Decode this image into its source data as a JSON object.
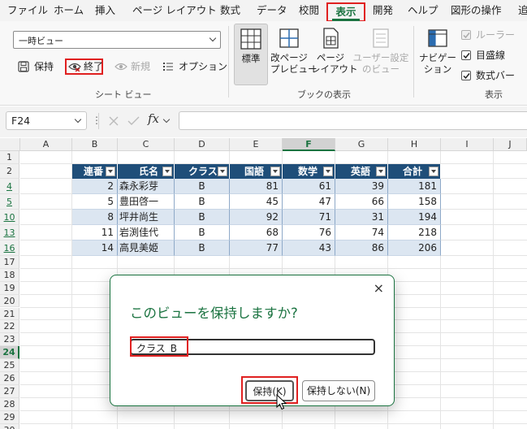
{
  "menu": {
    "items": [
      "ファイル",
      "ホーム",
      "挿入",
      "ページ レイアウト",
      "数式",
      "データ",
      "校閲",
      "表示",
      "開発",
      "ヘルプ",
      "図形の操作",
      "追"
    ],
    "active_index": 7
  },
  "ribbon": {
    "sheet_view": {
      "current": "一時ビュー",
      "keep": "保持",
      "exit": "終了",
      "new": "新規",
      "options": "オプション",
      "group_label": "シート ビュー"
    },
    "workbook_views": {
      "normal": "標準",
      "page_break": "改ページ\nプレビュー",
      "page_layout": "ページ\nレイアウト",
      "custom": "ユーザー設定\nのビュー",
      "group_label": "ブックの表示"
    },
    "show": {
      "navigation": "ナビゲー\nション",
      "ruler": "ルーラー",
      "gridlines": "目盛線",
      "formula_bar": "数式バー",
      "group_label": "表示"
    }
  },
  "formula_bar": {
    "name_box": "F24",
    "fx": "fx",
    "value": ""
  },
  "sheet": {
    "columns": [
      "A",
      "B",
      "C",
      "D",
      "E",
      "F",
      "G",
      "H",
      "I",
      "J"
    ],
    "selected_column": "F",
    "rows": [
      "1",
      "2",
      "4",
      "5",
      "10",
      "13",
      "16",
      "17",
      "18",
      "19",
      "20",
      "21",
      "22",
      "23",
      "24",
      "25",
      "26",
      "27",
      "28",
      "29",
      "30",
      "31"
    ],
    "selected_row": "24",
    "table": {
      "headers": [
        "連番",
        "氏名",
        "クラス",
        "国語",
        "数学",
        "英語",
        "合計"
      ],
      "data": [
        [
          "2",
          "森永彩芽",
          "B",
          "81",
          "61",
          "39",
          "181"
        ],
        [
          "5",
          "豊田啓一",
          "B",
          "45",
          "47",
          "66",
          "158"
        ],
        [
          "8",
          "坪井尚生",
          "B",
          "92",
          "71",
          "31",
          "194"
        ],
        [
          "11",
          "岩渕佳代",
          "B",
          "68",
          "76",
          "74",
          "218"
        ],
        [
          "14",
          "高見美姫",
          "B",
          "77",
          "43",
          "86",
          "206"
        ]
      ]
    }
  },
  "dialog": {
    "title": "このビューを保持しますか?",
    "input_value": "クラス_B",
    "keep_button": "保持(K)",
    "dont_keep_button": "保持しない(N)",
    "close": "×"
  },
  "colors": {
    "accent": "#1a7340",
    "table_header": "#1f4e79",
    "table_band": "#dce6f1",
    "highlight": "#e02020"
  }
}
